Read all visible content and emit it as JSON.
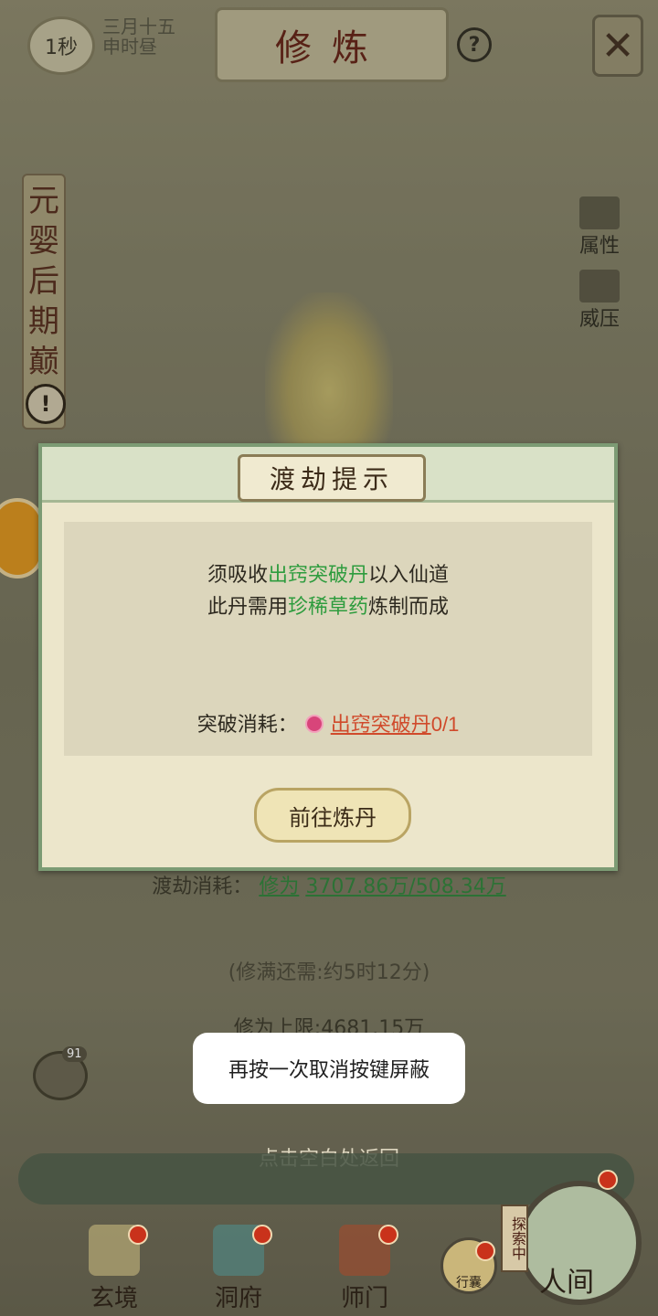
{
  "header": {
    "timer": "1秒",
    "date_line1": "三月十五",
    "date_line2": "申时昼",
    "title": "修炼",
    "help": "?",
    "close": "✕"
  },
  "realm": {
    "label": "元婴后期巅峰",
    "alert": "!"
  },
  "side_buttons": [
    {
      "label": "属性"
    },
    {
      "label": "威压"
    }
  ],
  "background_info": {
    "tribulation_cost_label": "渡劫消耗：",
    "tribulation_cost_item": "修为",
    "tribulation_cost_value": "3707.86万/508.34万",
    "remaining": "(修满还需:约5时12分)",
    "cultivation_cap": "修为上限:4681.15万"
  },
  "dialog": {
    "title": "渡劫提示",
    "line1_prefix": "须吸收",
    "line1_highlight": "出窍突破丹",
    "line1_suffix": "以入仙道",
    "line2_prefix": "此丹需用",
    "line2_highlight": "珍稀草药",
    "line2_suffix": "炼制而成",
    "cost_label": "突破消耗：",
    "cost_item": "出窍突破丹",
    "cost_count": "0/1",
    "button": "前往炼丹"
  },
  "toast": "再按一次取消按键屏蔽",
  "chat_badge": "91",
  "tap_return": "点击空白处返回",
  "nav": {
    "items": [
      "玄境",
      "洞府",
      "师门"
    ],
    "bag": "行囊",
    "explore": "探索中",
    "world": "人间"
  }
}
